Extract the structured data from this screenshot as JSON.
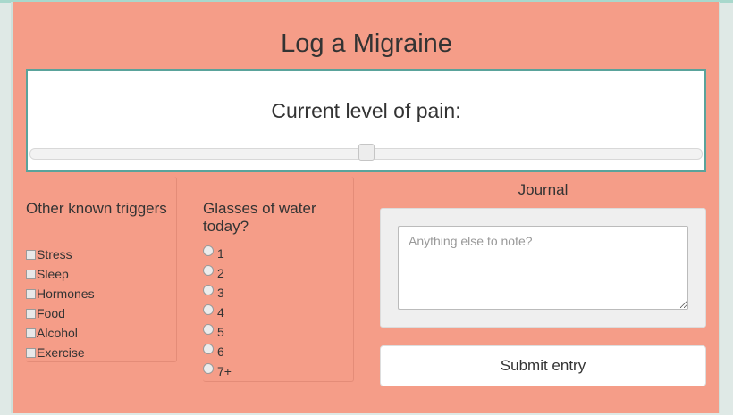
{
  "page": {
    "title": "Log a Migraine"
  },
  "pain": {
    "label": "Current level of pain:",
    "level_fraction": 0.5
  },
  "triggers": {
    "heading": "Other known triggers",
    "options": [
      "Stress",
      "Sleep",
      "Hormones",
      "Food",
      "Alcohol",
      "Exercise"
    ]
  },
  "water": {
    "heading": "Glasses of water today?",
    "options": [
      "1",
      "2",
      "3",
      "4",
      "5",
      "6",
      "7+"
    ]
  },
  "journal": {
    "label": "Journal",
    "placeholder": "Anything else to note?"
  },
  "submit": {
    "label": "Submit entry"
  }
}
